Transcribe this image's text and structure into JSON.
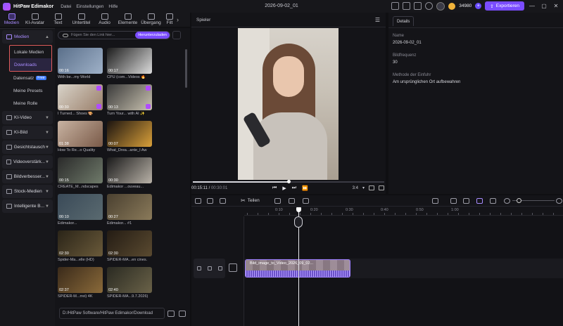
{
  "app": {
    "name": "HitPaw Edimakor",
    "menu": [
      "Datei",
      "Einstellungen",
      "Hilfe"
    ],
    "doc_title": "2026-09-02_01"
  },
  "header": {
    "credits": "34980",
    "plus": "+",
    "export_label": "Exportieren"
  },
  "toolbar": [
    {
      "label": "Medien",
      "icon": "media-icon",
      "active": true
    },
    {
      "label": "KI-Avatar",
      "icon": "avatar-icon"
    },
    {
      "label": "Text",
      "icon": "text-icon"
    },
    {
      "label": "Untertitel",
      "icon": "subtitle-icon"
    },
    {
      "label": "Audio",
      "icon": "audio-icon"
    },
    {
      "label": "Elemente",
      "icon": "elements-icon"
    },
    {
      "label": "Übergang",
      "icon": "transition-icon"
    },
    {
      "label": "Filt",
      "icon": "filter-icon"
    }
  ],
  "leftnav": {
    "media_section": "Medien",
    "local_media": "Lokale Medien",
    "downloads": "Downloads",
    "dataset": "Datensatz",
    "dataset_badge": "Free",
    "presets": "Meine Presets",
    "roles": "Meine Rolle",
    "sections": [
      "KI-Video",
      "KI-Bild",
      "Gesichtstausch",
      "Videoverstärk...",
      "Bildverbesser...",
      "Stock-Medien",
      "Intelligente B..."
    ]
  },
  "media": {
    "link_placeholder": "Fügen Sie den Link hier...",
    "download_label": "Herunterzuladen",
    "path": "D:/HitPaw Software/HitPaw Edimakor/Download",
    "items": [
      {
        "dur": "00:16",
        "title": "With be...my World"
      },
      {
        "dur": "00:17",
        "title": "CPU (com...Videos 🔥"
      },
      {
        "dur": "00:30",
        "title": "I Turned... Shoes 🎨"
      },
      {
        "dur": "00:13",
        "title": "Turn Your... with AI ✨"
      },
      {
        "dur": "01:38",
        "title": "How To Re...o Quality"
      },
      {
        "dur": "00:07",
        "title": "What_Drea...ante_I Aw"
      },
      {
        "dur": "00:15",
        "title": "CREATE_M...ndscapes"
      },
      {
        "dur": "00:30",
        "title": "Edimakor ...ouveau..."
      },
      {
        "dur": "00:10",
        "title": "Edimakor..."
      },
      {
        "dur": "00:27",
        "title": "Edimakor... #1"
      },
      {
        "dur": "02:30",
        "title": "Spider-Ma...elle (HD)"
      },
      {
        "dur": "02:30",
        "title": "SPIDER-MA...en cines."
      },
      {
        "dur": "02:37",
        "title": "SPIDER-M...rrei) 4K"
      },
      {
        "dur": "02:40",
        "title": "SPIDER-MA...9.7.2026)"
      }
    ]
  },
  "player": {
    "title": "Spieler",
    "current": "00:15:11",
    "total": "00:30:01",
    "progress": 0.5,
    "ratio": "3:4"
  },
  "details": {
    "tab": "Details",
    "name_label": "Name",
    "name_value": "2026-09-02_01",
    "fps_label": "Bildfrequenz",
    "fps_value": "30",
    "method_label": "Methode der Einfuhr",
    "method_value": "Am ursprünglichen Ort aufbewahren"
  },
  "timeline": {
    "split_label": "Teilen",
    "ruler": [
      "0:10",
      "0:20",
      "0:30",
      "0:40",
      "0:50",
      "1:00"
    ],
    "clip_name": "Bild_image_to_Video_2026_09_02...",
    "zoom": 0.1
  },
  "colors": {
    "accent": "#7a4cff",
    "highlight_box": "#e05c5c"
  }
}
